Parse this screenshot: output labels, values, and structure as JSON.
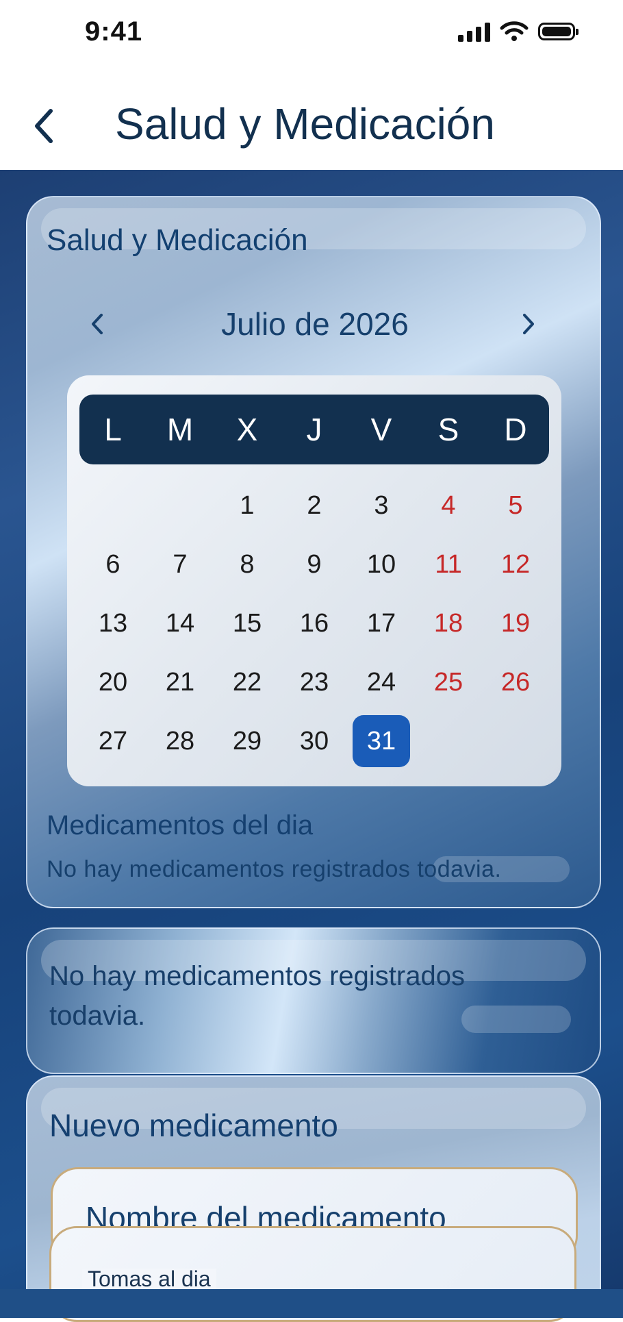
{
  "status_bar": {
    "time": "9:41"
  },
  "header": {
    "title": "Salud y Medicación"
  },
  "health_card": {
    "title": "Salud y Medicación",
    "month_label": "Julio de 2026",
    "weekdays": [
      "L",
      "M",
      "X",
      "J",
      "V",
      "S",
      "D"
    ],
    "days": [
      "1",
      "2",
      "3",
      "4",
      "5",
      "6",
      "7",
      "8",
      "9",
      "10",
      "11",
      "12",
      "13",
      "14",
      "15",
      "16",
      "17",
      "18",
      "19",
      "20",
      "21",
      "22",
      "23",
      "24",
      "25",
      "26",
      "27",
      "28",
      "29",
      "30",
      "31"
    ],
    "first_weekday_index": 2,
    "weekend_color": "#c62828",
    "selected_day": "31",
    "selected_color": "#1a5cb8",
    "section_title": "Medicamentos del dia",
    "empty_text": "No hay medicamentos registrados todavia."
  },
  "list_card": {
    "empty_text": "No hay medicamentos registrados todavia."
  },
  "new_med_card": {
    "title": "Nuevo medicamento",
    "name_field_value": "Nombre del medicamento",
    "doses_label": "Tomas al dia"
  },
  "colors": {
    "header_dark": "#12304f",
    "accent_text": "#16406d"
  },
  "icons": {
    "back": "chevron-left-icon",
    "prev_month": "chevron-left-icon",
    "next_month": "chevron-right-icon"
  }
}
